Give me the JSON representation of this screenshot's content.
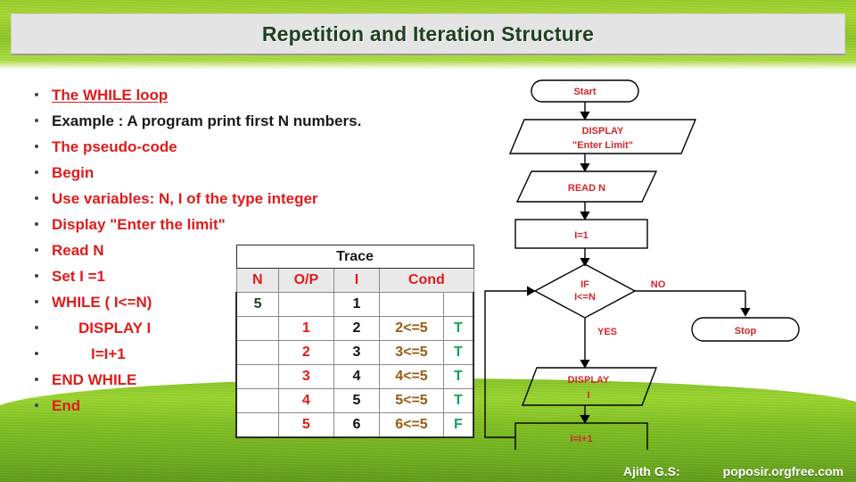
{
  "slide": {
    "title": "Repetition and Iteration Structure"
  },
  "footer": {
    "author": "Ajith G.S:",
    "site": "poposir.orgfree.com"
  },
  "bullets": [
    {
      "text": "The WHILE loop",
      "style": "red-underline",
      "indent": 0
    },
    {
      "text": "Example : A program print first N numbers.",
      "style": "black",
      "indent": 0
    },
    {
      "text": "The pseudo-code",
      "style": "red",
      "indent": 0
    },
    {
      "text": "Begin",
      "style": "red",
      "indent": 0
    },
    {
      "text": "Use variables: N, I of the type integer",
      "style": "red",
      "indent": 0
    },
    {
      "text": "Display \"Enter the limit\"",
      "style": "red",
      "indent": 0
    },
    {
      "text": "Read N",
      "style": "red",
      "indent": 0
    },
    {
      "text": "Set I =1",
      "style": "red",
      "indent": 0
    },
    {
      "text": "WHILE ( I<=N)",
      "style": "red",
      "indent": 0
    },
    {
      "text": "DISPLAY I",
      "style": "red",
      "indent": 1
    },
    {
      "text": "I=I+1",
      "style": "red",
      "indent": 2
    },
    {
      "text": "END WHILE",
      "style": "red",
      "indent": 0
    },
    {
      "text": "End",
      "style": "red",
      "indent": 0
    }
  ],
  "bullet_marker": "•",
  "trace": {
    "title": "Trace",
    "headers": [
      "N",
      "O/P",
      "I",
      "Cond",
      ""
    ],
    "rows": [
      {
        "n": "5",
        "op": "",
        "i": "1",
        "cond": "",
        "tf": ""
      },
      {
        "n": "",
        "op": "1",
        "i": "2",
        "cond": "2<=5",
        "tf": "T"
      },
      {
        "n": "",
        "op": "2",
        "i": "3",
        "cond": "3<=5",
        "tf": "T"
      },
      {
        "n": "",
        "op": "3",
        "i": "4",
        "cond": "4<=5",
        "tf": "T"
      },
      {
        "n": "",
        "op": "4",
        "i": "5",
        "cond": "5<=5",
        "tf": "T"
      },
      {
        "n": "",
        "op": "5",
        "i": "6",
        "cond": "6<=5",
        "tf": "F"
      }
    ]
  },
  "flowchart": {
    "start": "Start",
    "display_limit_line1": "DISPLAY",
    "display_limit_line2": "\"Enter Limit\"",
    "read_n": "READ N",
    "init_i": "I=1",
    "decision_line1": "IF",
    "decision_line2": "I<=N",
    "label_no": "NO",
    "label_yes": "YES",
    "stop": "Stop",
    "display_i_line1": "DISPLAY",
    "display_i_line2": "I",
    "increment": "I=I+1"
  },
  "colors": {
    "title": "#1d4220",
    "bullet_red": "#e01b1b",
    "bullet_black": "#1a1a1a",
    "flow_red": "#d3262b",
    "cond_brown": "#9a5a10",
    "tf_green": "#17a05a",
    "grass_green": "#8cc426",
    "plate_gray": "#e4e4e4"
  }
}
